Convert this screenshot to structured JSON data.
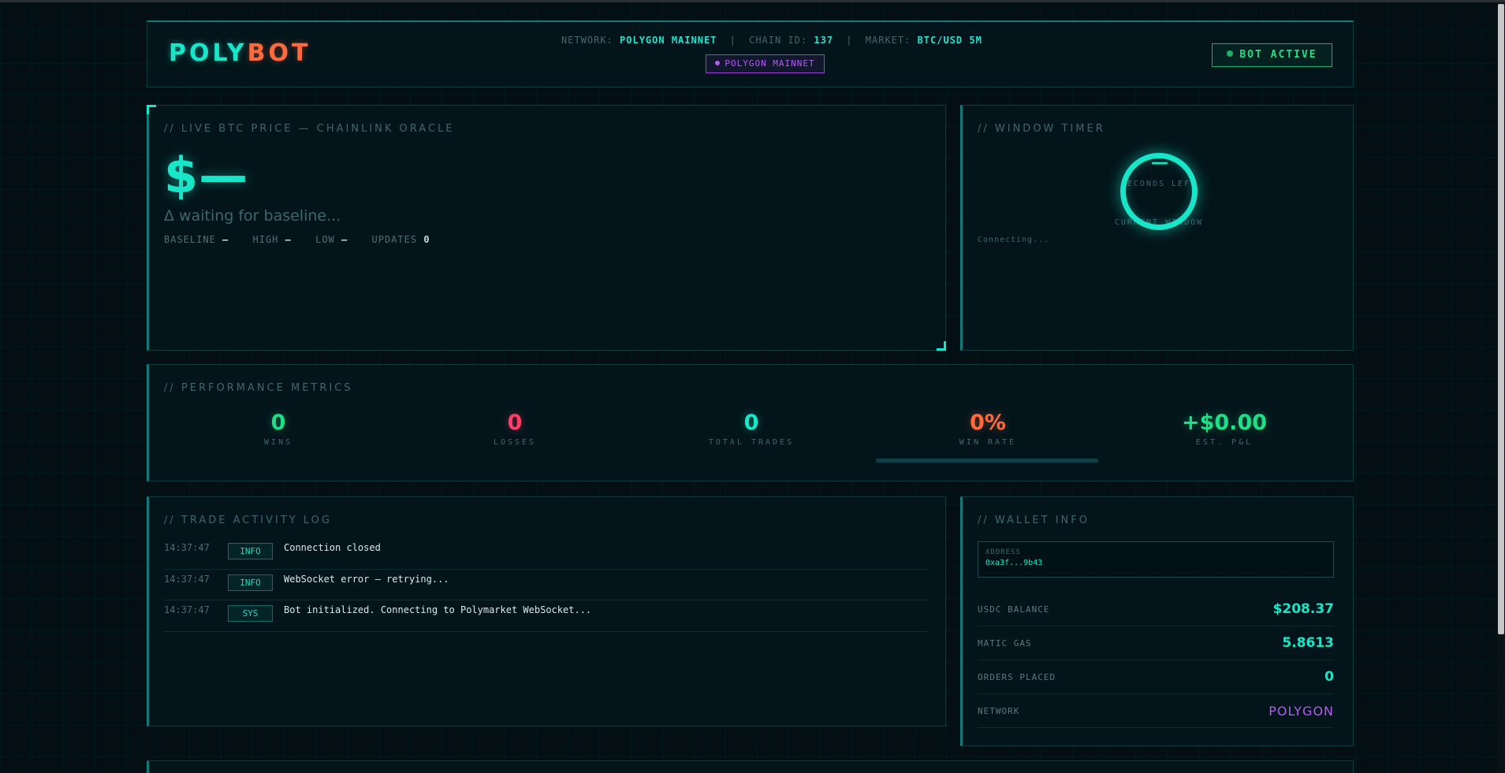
{
  "header": {
    "logo_a": "POLY",
    "logo_b": "BOT",
    "network_label": "NETWORK:",
    "network_value": "POLYGON MAINNET",
    "separator": "|",
    "chain_label": "CHAIN ID:",
    "chain_value": "137",
    "market_label": "MARKET:",
    "market_value": "BTC/USD 5M",
    "network_badge": "POLYGON MAINNET",
    "bot_status": "BOT ACTIVE"
  },
  "price": {
    "title": "// LIVE BTC PRICE — CHAINLINK ORACLE",
    "value": "$—",
    "delta": "Δ waiting for baseline...",
    "baseline_label": "BASELINE",
    "baseline_value": "—",
    "high_label": "HIGH",
    "high_value": "—",
    "low_label": "LOW",
    "low_value": "—",
    "updates_label": "UPDATES",
    "updates_value": "0"
  },
  "timer": {
    "title": "// WINDOW TIMER",
    "value": "—",
    "sub_label": "SECONDS LEFT",
    "window_label": "CURRENT WINDOW",
    "status": "Connecting..."
  },
  "metrics": {
    "title": "// PERFORMANCE METRICS",
    "items": [
      {
        "value": "0",
        "label": "WINS",
        "color": "#22dd88"
      },
      {
        "value": "0",
        "label": "LOSSES",
        "color": "#ff3d6b"
      },
      {
        "value": "0",
        "label": "TOTAL TRADES",
        "color": "#19e6c8"
      },
      {
        "value": "0%",
        "label": "WIN RATE",
        "color": "#ff6a3d"
      },
      {
        "value": "+$0.00",
        "label": "EST. P&L",
        "color": "#22dd88"
      }
    ],
    "win_rate_fraction": 0
  },
  "log": {
    "title": "// TRADE ACTIVITY LOG",
    "entries": [
      {
        "time": "14:37:47",
        "tag": "INFO",
        "message": "Connection closed"
      },
      {
        "time": "14:37:47",
        "tag": "INFO",
        "message": "WebSocket error — retrying..."
      },
      {
        "time": "14:37:47",
        "tag": "SYS",
        "message": "Bot initialized. Connecting to Polymarket WebSocket..."
      }
    ]
  },
  "wallet": {
    "title": "// WALLET INFO",
    "address_label": "ADDRESS",
    "address_value": "0xa3f...9b43",
    "usdc_label": "USDC BALANCE",
    "usdc_value": "$208.37",
    "matic_label": "MATIC GAS",
    "matic_value": "5.8613",
    "orders_label": "ORDERS PLACED",
    "orders_value": "0",
    "network_label": "NETWORK",
    "network_value": "POLYGON"
  }
}
